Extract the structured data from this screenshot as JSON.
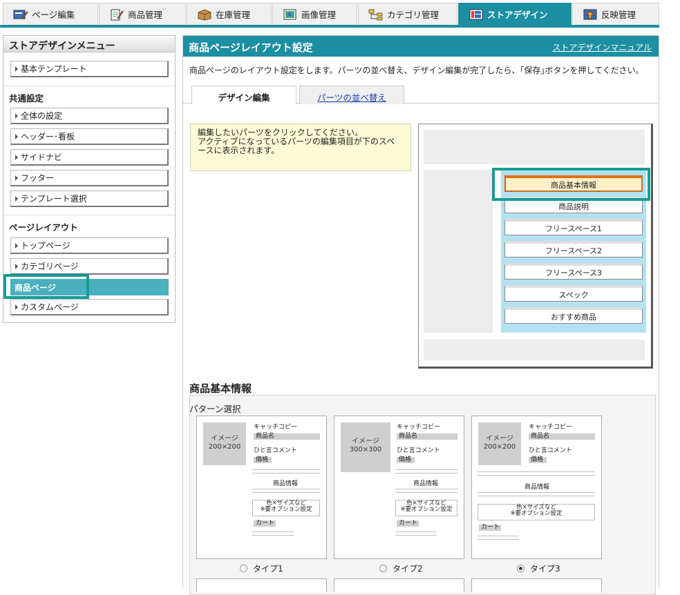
{
  "tabs": [
    {
      "label": "ページ編集",
      "icon": "page-edit-icon"
    },
    {
      "label": "商品管理",
      "icon": "product-icon"
    },
    {
      "label": "在庫管理",
      "icon": "inventory-box-icon"
    },
    {
      "label": "画像管理",
      "icon": "image-icon"
    },
    {
      "label": "カテゴリ管理",
      "icon": "category-tree-icon"
    },
    {
      "label": "ストアデザイン",
      "icon": "store-design-icon"
    },
    {
      "label": "反映管理",
      "icon": "publish-icon"
    }
  ],
  "sidebar": {
    "title": "ストアデザインメニュー",
    "top_item": "基本テンプレート",
    "group1": "共通設定",
    "group1_items": [
      "全体の設定",
      "ヘッダー･看板",
      "サイドナビ",
      "フッター",
      "テンプレート選択"
    ],
    "group2": "ページレイアウト",
    "group2_items": [
      "トップページ",
      "カテゴリページ",
      "商品ページ",
      "カスタムページ"
    ]
  },
  "main": {
    "title": "商品ページレイアウト設定",
    "manual_link": "ストアデザインマニュアル",
    "description": "商品ページのレイアウト設定をします。パーツの並べ替え、デザイン編集が完了したら、｢保存｣ボタンを押してください。",
    "tab_design": "デザイン編集",
    "tab_reorder": "パーツの並べ替え",
    "note_line1": "編集したいパーツをクリックしてください。",
    "note_line2": "アクティブになっているパーツの編集項目が下のスペ",
    "note_line3": "ースに表示されます。",
    "parts": [
      "商品基本情報",
      "商品説明",
      "フリースペース1",
      "フリースペース2",
      "フリースペース3",
      "スペック",
      "おすすめ商品"
    ],
    "section_title": "商品基本情報",
    "pattern_label": "パターン選択",
    "pattern": {
      "catch": "キャッチコピー",
      "name": "商品名",
      "comment": "ひと言コメント",
      "price": "価格",
      "info": "商品情報",
      "opt1": "色×サイズなど",
      "opt2": "※要オプション設定",
      "cart": "カート",
      "img_label": "イメージ"
    },
    "types": [
      {
        "label": "タイプ1",
        "size": "200×200",
        "selected": false
      },
      {
        "label": "タイプ2",
        "size": "300×300",
        "selected": false
      },
      {
        "label": "タイプ3",
        "size": "200×200",
        "selected": true
      }
    ]
  }
}
